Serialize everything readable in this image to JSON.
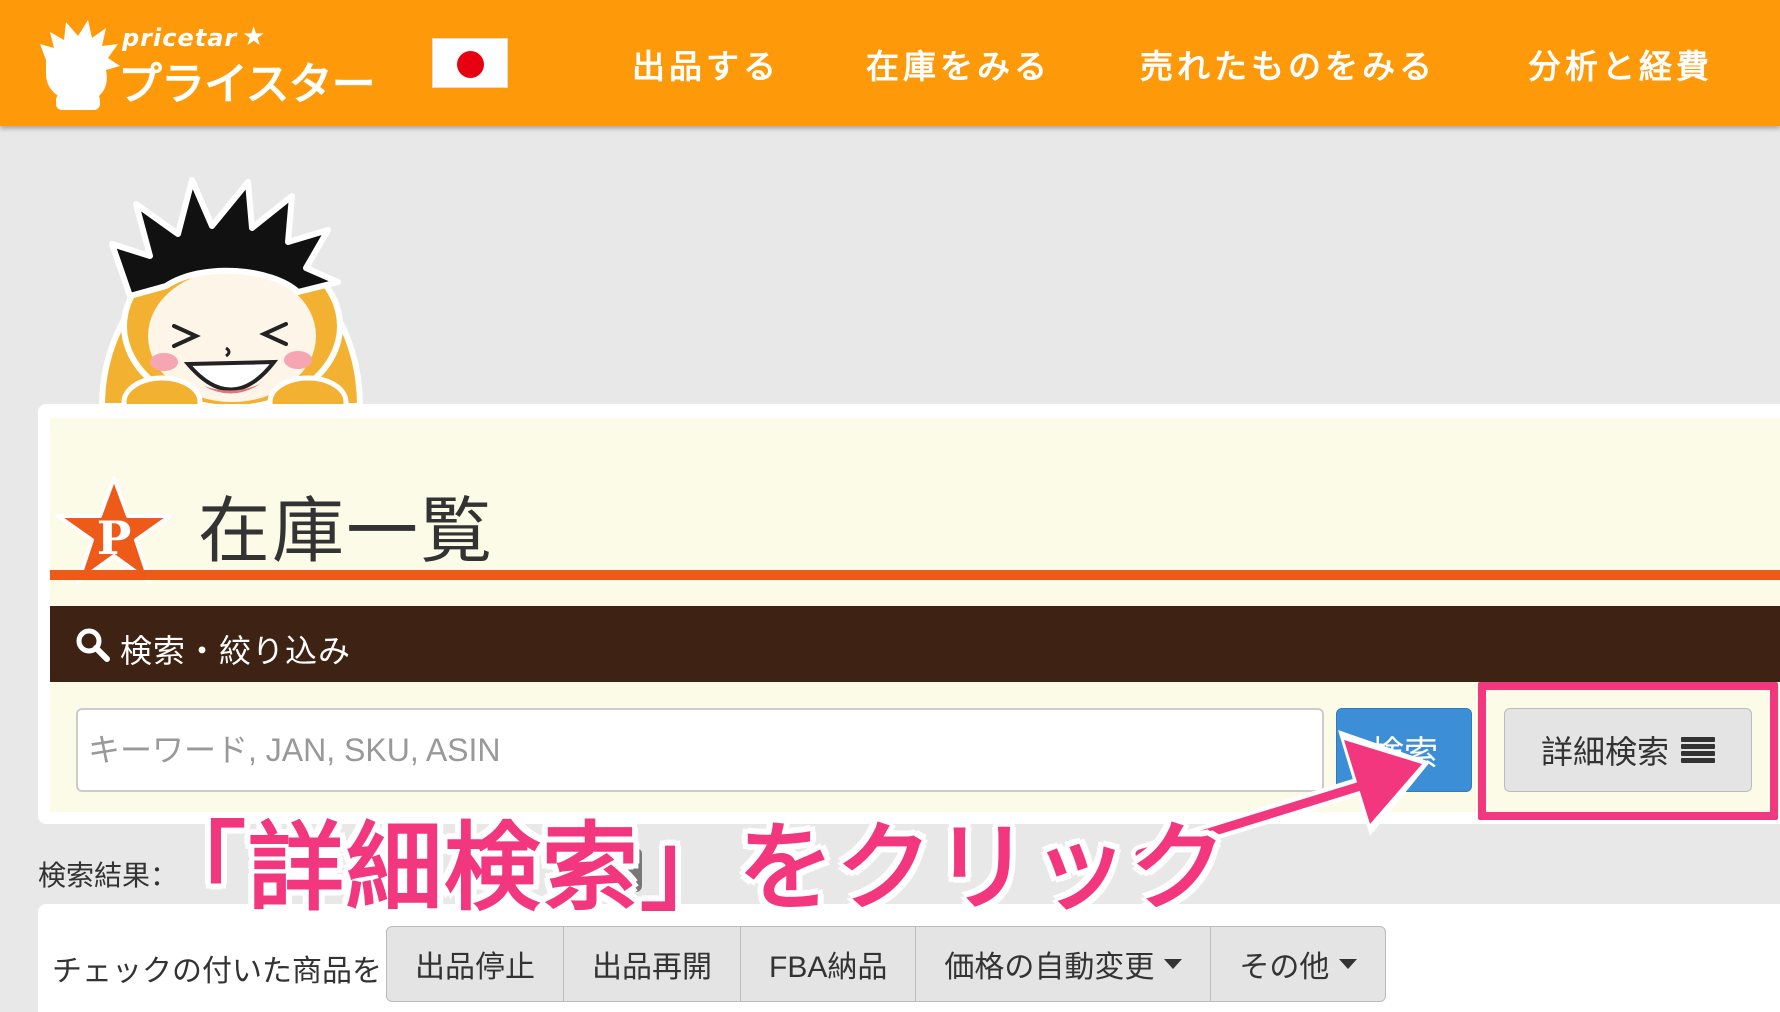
{
  "header": {
    "logo_small": "pricetar",
    "logo_main": "プライスター",
    "flag": "japan-flag",
    "nav": [
      {
        "label": "出品する"
      },
      {
        "label": "在庫をみる"
      },
      {
        "label": "売れたものをみる"
      },
      {
        "label": "分析と経費"
      }
    ]
  },
  "page": {
    "title": "在庫一覧",
    "badge_letter": "P"
  },
  "search": {
    "section_label": "検索・絞り込み",
    "placeholder": "キーワード, JAN, SKU, ASIN",
    "value": "",
    "search_button": "検索",
    "detail_button": "詳細検索"
  },
  "results": {
    "label": "検索結果：",
    "badge": "中"
  },
  "bulk": {
    "label": "チェックの付いた商品を",
    "buttons": [
      {
        "label": "出品停止",
        "dropdown": false
      },
      {
        "label": "出品再開",
        "dropdown": false
      },
      {
        "label": "FBA納品",
        "dropdown": false
      },
      {
        "label": "価格の自動変更",
        "dropdown": true
      },
      {
        "label": "その他",
        "dropdown": true
      }
    ]
  },
  "annotation": {
    "text": "「詳細検索」をクリック",
    "color": "#f2377e"
  },
  "colors": {
    "topbar": "#fe9a0a",
    "rule": "#ee5a17",
    "search_header": "#3e2213",
    "primary_button": "#3c8fd6",
    "highlight": "#f2377e"
  }
}
